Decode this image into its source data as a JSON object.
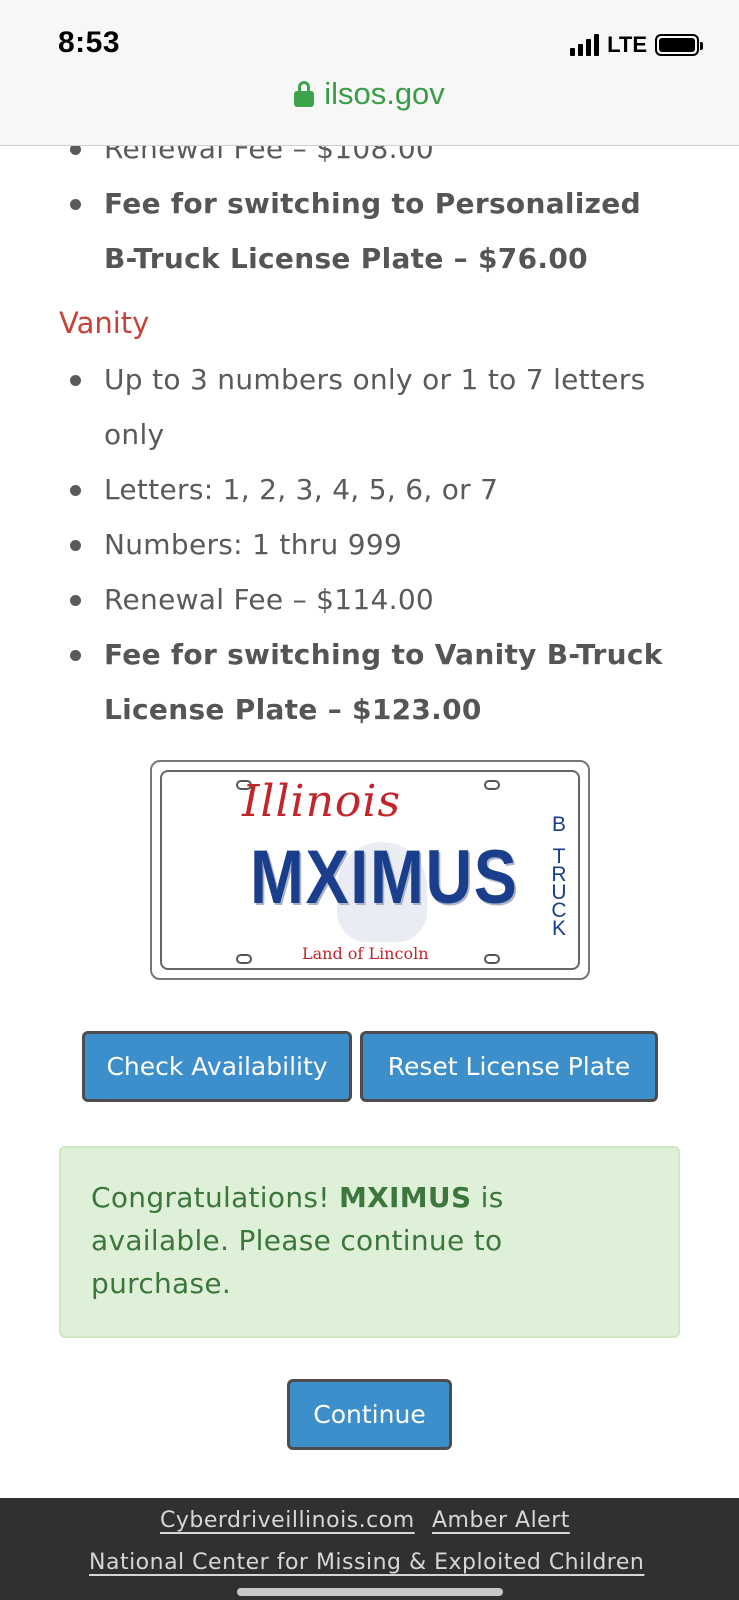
{
  "status_bar": {
    "time": "8:53",
    "network": "LTE"
  },
  "url_bar": {
    "domain": "ilsos.gov"
  },
  "personalized_list": [
    {
      "text": "Renewal Fee – $108.00",
      "bold": false
    },
    {
      "text": "Fee for switching to Personalized B-Truck License Plate – $76.00",
      "bold": true
    }
  ],
  "vanity": {
    "heading": "Vanity",
    "items": [
      {
        "text": "Up to 3 numbers only or 1 to 7 letters only",
        "bold": false
      },
      {
        "text": "Letters: 1, 2, 3, 4, 5, 6, or 7",
        "bold": false
      },
      {
        "text": "Numbers: 1 thru 999",
        "bold": false
      },
      {
        "text": "Renewal Fee – $114.00",
        "bold": false
      },
      {
        "text": "Fee for switching to Vanity B-Truck License Plate – $123.00",
        "bold": true
      }
    ]
  },
  "plate": {
    "state": "Illinois",
    "number": "MXIMUS",
    "motto": "Land of Lincoln",
    "side_top": "B",
    "side_letters": [
      "T",
      "R",
      "U",
      "C",
      "K"
    ]
  },
  "buttons": {
    "check_availability": "Check Availability",
    "reset_plate": "Reset License Plate",
    "continue": "Continue"
  },
  "alert": {
    "prefix": "Congratulations! ",
    "plate_name": "MXIMUS",
    "suffix": " is available. Please continue to purchase."
  },
  "footer": {
    "link1": "Cyberdriveillinois.com",
    "link2": "Amber Alert",
    "link3": "National Center for Missing & Exploited Children"
  },
  "colors": {
    "url_green": "#3a9c46",
    "vanity_red": "#c9413b",
    "button_blue": "#3d8fcc",
    "alert_bg": "#dff0d8",
    "alert_text": "#3c763d",
    "footer_bg": "#303030"
  }
}
